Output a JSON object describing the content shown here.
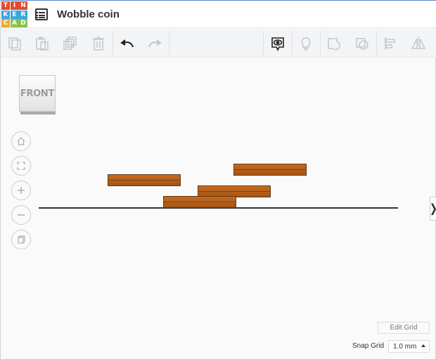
{
  "app": {
    "logo_letters": [
      "T",
      "I",
      "N",
      "K",
      "E",
      "R",
      "C",
      "A",
      "D"
    ],
    "logo_colors": [
      "#e34a2f",
      "#e34a2f",
      "#e34a2f",
      "#3aa6dd",
      "#3aa6dd",
      "#3aa6dd",
      "#f3a531",
      "#8bc34a",
      "#8bc34a"
    ],
    "title": "Wobble coin"
  },
  "toolbar": {
    "icons": [
      "copy-icon",
      "paste-icon",
      "duplicate-icon",
      "delete-icon",
      "undo-icon",
      "redo-icon",
      "show-hide-icon",
      "lightbulb-icon",
      "group-icon",
      "ungroup-icon",
      "align-icon",
      "mirror-icon"
    ]
  },
  "viewcube": {
    "face_label": "FRONT"
  },
  "nav": {
    "icons": [
      "home-icon",
      "fit-icon",
      "zoom-in-icon",
      "zoom-out-icon",
      "perspective-icon"
    ]
  },
  "scene": {
    "coin_color": "#b8601a",
    "coin_count": 4
  },
  "grid": {
    "edit_grid_label": "Edit Grid",
    "snap_grid_label": "Snap Grid",
    "snap_grid_value": "1.0 mm"
  }
}
